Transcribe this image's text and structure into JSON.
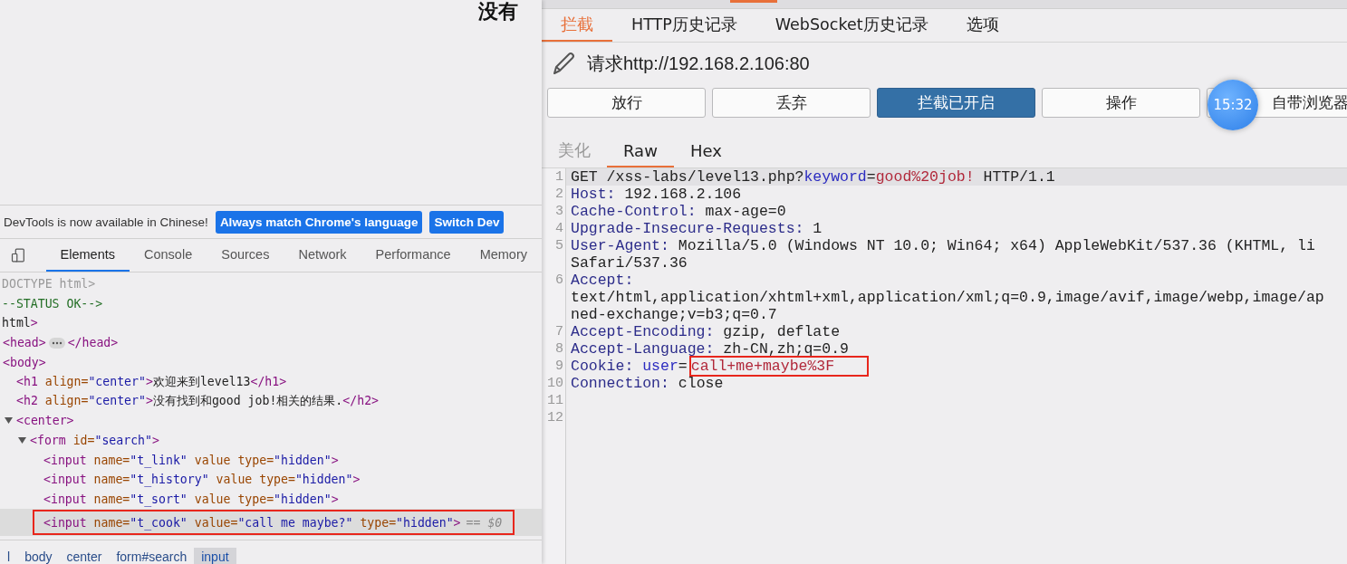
{
  "browser": {
    "page_heading": "没有",
    "devtools": {
      "banner": {
        "message": "DevTools is now available in Chinese!",
        "buttons": [
          "Always match Chrome's language",
          "Switch Dev"
        ]
      },
      "tabs": [
        {
          "label": "Elements",
          "selected": true
        },
        {
          "label": "Console",
          "selected": false
        },
        {
          "label": "Sources",
          "selected": false
        },
        {
          "label": "Network",
          "selected": false
        },
        {
          "label": "Performance",
          "selected": false
        },
        {
          "label": "Memory",
          "selected": false
        }
      ],
      "dom_tree": [
        {
          "kind": "doctype",
          "text": "DOCTYPE html>",
          "selected": false
        },
        {
          "kind": "comment",
          "text": "--STATUS OK-->",
          "selected": false
        },
        {
          "kind": "element",
          "text": "html>",
          "selected": false,
          "children": [
            {
              "kind": "element",
              "text": "<head>",
              "closing": "</head>",
              "expanded": false,
              "selected": false
            },
            {
              "kind": "element",
              "text": "<body>",
              "selected": false,
              "children": [
                {
                  "kind": "element",
                  "text": "<h1 align=\"center\">欢迎来到level13</h1>",
                  "selected": false
                },
                {
                  "kind": "element",
                  "text": "<h2 align=\"center\">没有找到和good job!相关的结果.</h2>",
                  "selected": false
                },
                {
                  "kind": "element",
                  "text": "<center>",
                  "expanded": true,
                  "selected": false,
                  "children": [
                    {
                      "kind": "element",
                      "text": "<form id=\"search\">",
                      "expanded": true,
                      "selected": false,
                      "children": [
                        {
                          "kind": "element",
                          "text": "<input name=\"t_link\" value type=\"hidden\">",
                          "selected": false
                        },
                        {
                          "kind": "element",
                          "text": "<input name=\"t_history\" value type=\"hidden\">",
                          "selected": false
                        },
                        {
                          "kind": "element",
                          "text": "<input name=\"t_sort\" value type=\"hidden\">",
                          "selected": false
                        },
                        {
                          "kind": "element",
                          "text": "<input name=\"t_cook\" value=\"call me maybe?\" type=\"hidden\">",
                          "suffix": "== $0",
                          "selected": true,
                          "boxed": true
                        }
                      ]
                    }
                  ]
                }
              ]
            }
          ]
        }
      ],
      "breadcrumbs": [
        {
          "label": "l",
          "selected": false
        },
        {
          "label": "body",
          "selected": false
        },
        {
          "label": "center",
          "selected": false
        },
        {
          "label": "form#search",
          "selected": false
        },
        {
          "label": "input",
          "selected": true
        }
      ]
    }
  },
  "proxy": {
    "tabs": [
      {
        "label": "拦截",
        "selected": true
      },
      {
        "label": "HTTP历史记录",
        "selected": false
      },
      {
        "label": "WebSocket历史记录",
        "selected": false
      },
      {
        "label": "选项",
        "selected": false
      }
    ],
    "request_title": "请求http://192.168.2.106:80",
    "buttons": [
      {
        "label": "放行",
        "selected": false
      },
      {
        "label": "丢弃",
        "selected": false
      },
      {
        "label": "拦截已开启",
        "selected": true
      },
      {
        "label": "操作",
        "selected": false
      },
      {
        "label": "自带浏览器",
        "selected": false
      }
    ],
    "clock_badge": "15:32",
    "view_tabs": [
      {
        "label": "美化",
        "selected": false,
        "disabled": true
      },
      {
        "label": "Raw",
        "selected": true,
        "disabled": false
      },
      {
        "label": "Hex",
        "selected": false,
        "disabled": false
      }
    ],
    "lines": [
      {
        "number": "1",
        "current": true,
        "segments": [
          {
            "kind": "plain",
            "text": "GET /xss-labs/level13.php?"
          },
          {
            "kind": "param",
            "text": "keyword"
          },
          {
            "kind": "plain",
            "text": "="
          },
          {
            "kind": "value",
            "text": "good%20job!"
          },
          {
            "kind": "plain",
            "text": " HTTP/1.1"
          }
        ]
      },
      {
        "number": "2",
        "current": false,
        "segments": [
          {
            "kind": "name",
            "text": "Host:"
          },
          {
            "kind": "plain",
            "text": " 192.168.2.106"
          }
        ]
      },
      {
        "number": "3",
        "current": false,
        "segments": [
          {
            "kind": "name",
            "text": "Cache-Control:"
          },
          {
            "kind": "plain",
            "text": " max-age=0"
          }
        ]
      },
      {
        "number": "4",
        "current": false,
        "segments": [
          {
            "kind": "name",
            "text": "Upgrade-Insecure-Requests:"
          },
          {
            "kind": "plain",
            "text": " 1"
          }
        ]
      },
      {
        "number": "5",
        "current": false,
        "segments": [
          {
            "kind": "name",
            "text": "User-Agent:"
          },
          {
            "kind": "plain",
            "text": " Mozilla/5.0 (Windows NT 10.0; Win64; x64) AppleWebKit/537.36 (KHTML, li"
          }
        ],
        "continuation": [
          "Safari/537.36"
        ]
      },
      {
        "number": "6",
        "current": false,
        "segments": [
          {
            "kind": "name",
            "text": "Accept:"
          }
        ],
        "continuation": [
          "text/html,application/xhtml+xml,application/xml;q=0.9,image/avif,image/webp,image/ap",
          "ned-exchange;v=b3;q=0.7"
        ]
      },
      {
        "number": "7",
        "current": false,
        "segments": [
          {
            "kind": "name",
            "text": "Accept-Encoding:"
          },
          {
            "kind": "plain",
            "text": " gzip, deflate"
          }
        ]
      },
      {
        "number": "8",
        "current": false,
        "segments": [
          {
            "kind": "name",
            "text": "Accept-Language:"
          },
          {
            "kind": "plain",
            "text": " zh-CN,zh;q=0.9"
          }
        ]
      },
      {
        "number": "9",
        "current": false,
        "segments": [
          {
            "kind": "name",
            "text": "Cookie:"
          },
          {
            "kind": "param",
            "text": " user"
          },
          {
            "kind": "plain",
            "text": "="
          },
          {
            "kind": "value",
            "text": "call+me+maybe%3F",
            "boxed": true
          }
        ]
      },
      {
        "number": "10",
        "current": false,
        "segments": [
          {
            "kind": "name",
            "text": "Connection:"
          },
          {
            "kind": "plain",
            "text": " close"
          }
        ]
      },
      {
        "number": "11",
        "current": false
      },
      {
        "number": "12",
        "current": false
      }
    ]
  }
}
